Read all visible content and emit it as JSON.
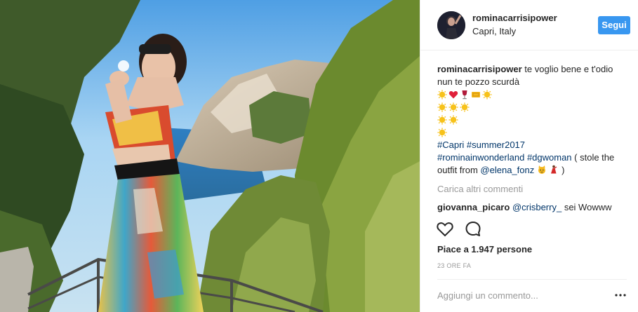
{
  "post": {
    "username": "rominacarrisipower",
    "location": "Capri, Italy",
    "follow_label": "Segui",
    "caption_text": "te voglio bene e t'odio nun te pozzo scurdà",
    "hashtags_line1": "#Capri #summer2017",
    "hashtags_line2_a": "#rominainwonderland",
    "hashtags_line2_b": "#dgwoman",
    "caption_tail": "( stole the outfit from",
    "mention_elena": "@elena_fonz",
    "caption_end": ")",
    "load_more": "Carica altri commenti",
    "comment": {
      "user": "giovanna_picaro",
      "mention": "@crisberry_",
      "text": "sei Wowww"
    },
    "likes": "Piace a 1.947 persone",
    "time": "23 ORE FA",
    "comment_placeholder": "Aggiungi un commento..."
  },
  "icons": [
    "sun-emoji",
    "heart-emoji",
    "wine-emoji",
    "ticket-emoji",
    "heart-outline-icon",
    "comment-icon",
    "more-icon"
  ],
  "colors": {
    "follow": "#3897f0",
    "link": "#003569",
    "muted": "#999999",
    "text": "#262626"
  }
}
